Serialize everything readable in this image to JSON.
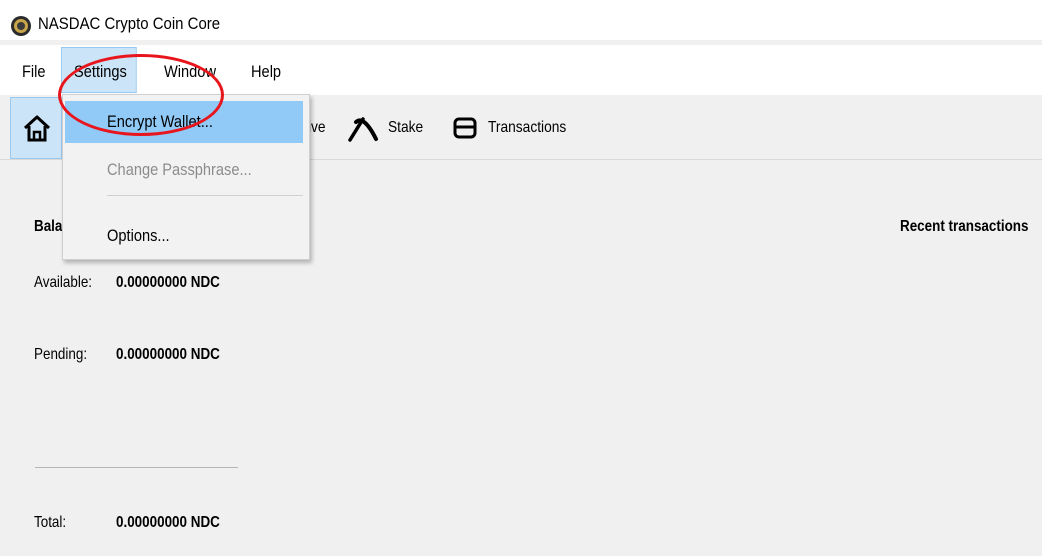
{
  "window": {
    "title": "NASDAC Crypto Coin Core",
    "icon": "nasdac-coin-icon"
  },
  "menubar": {
    "items": [
      {
        "label": "File"
      },
      {
        "label": "Settings"
      },
      {
        "label": "Window"
      },
      {
        "label": "Help"
      }
    ],
    "active": "Settings"
  },
  "toolbar": {
    "home_icon": "home-icon",
    "receive_partial": "ive",
    "stake_label": "Stake",
    "stake_icon": "pickaxe-icon",
    "transactions_label": "Transactions",
    "transactions_icon": "wallet-card-icon"
  },
  "settings_menu": {
    "encrypt_wallet": "Encrypt Wallet...",
    "change_passphrase": "Change Passphrase...",
    "options": "Options..."
  },
  "overview": {
    "balances_partial": "Bala",
    "available_label": "Available:",
    "available_value": "0.00000000 NDC",
    "pending_label": "Pending:",
    "pending_value": "0.00000000 NDC",
    "total_label": "Total:",
    "total_value": "0.00000000 NDC",
    "recent_transactions": "Recent transactions"
  },
  "colors": {
    "highlight": "#cce4f7",
    "menu_hover": "#91c9f7",
    "annotation": "#e8161c"
  }
}
